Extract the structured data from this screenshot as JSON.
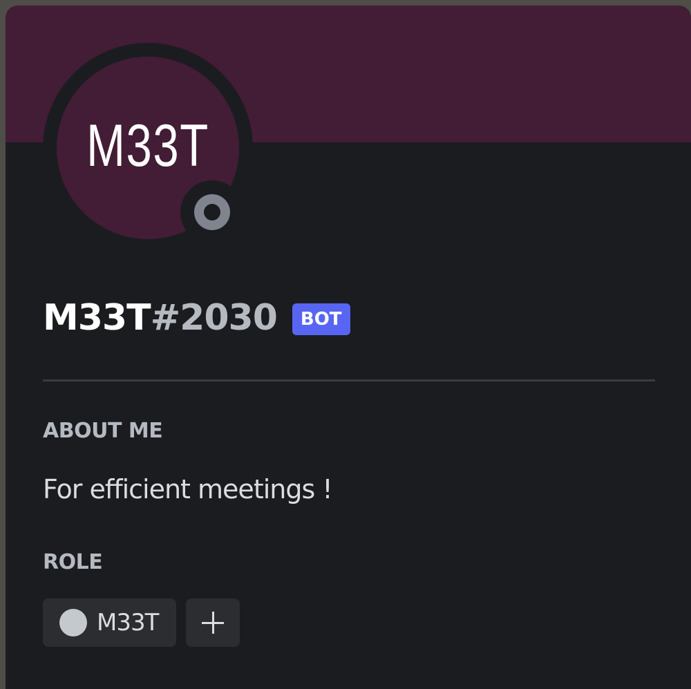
{
  "profile": {
    "avatar_text": "M33T",
    "username": "M33T",
    "discriminator": "#2030",
    "badge": "BOT",
    "status": "offline",
    "status_icon": "offline-status-icon"
  },
  "about": {
    "title": "ABOUT ME",
    "text": "For efficient meetings !"
  },
  "roles": {
    "title": "ROLE",
    "items": [
      {
        "name": "M33T",
        "color": "#c4c9ce"
      }
    ],
    "add_icon": "plus-icon"
  },
  "colors": {
    "banner": "#431c35",
    "card_background": "#1b1c20",
    "badge": "#5865f2"
  }
}
